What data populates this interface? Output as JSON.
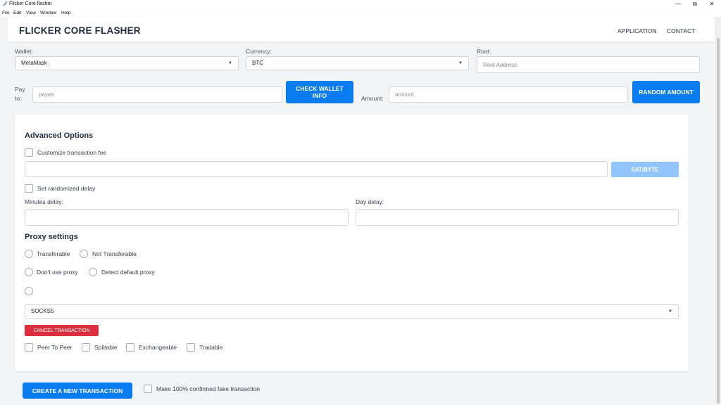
{
  "window": {
    "title": "Flicker Core flasher",
    "minimize": "—",
    "restore": "⧉",
    "close": "✕"
  },
  "menu": [
    "File",
    "Edit",
    "View",
    "Window",
    "Help"
  ],
  "navbar": {
    "brand": "FLICKER CORE FLASHER",
    "links": [
      "APPLICATION",
      "CONTACT"
    ]
  },
  "wallet": {
    "label": "Wallet:",
    "selected": "MetaMask"
  },
  "currency": {
    "label": "Currency:",
    "selected": "BTC"
  },
  "root": {
    "label": "Root:",
    "placeholder": "Root Address"
  },
  "pay_to": {
    "label": "Pay to:",
    "placeholder": "payee"
  },
  "check_wallet_button": "CHECK WALLET INFO",
  "amount": {
    "label": "Amount:",
    "placeholder": "amount"
  },
  "random_amount_button": "RANDOM AMOUNT",
  "advanced": {
    "title": "Advanced Options",
    "customize_fee_label": "Customize transaction fee",
    "sat_byte_button": "SAT/BYTE",
    "randomized_delay_label": "Set randomized delay",
    "minutes_delay_label": "Minutes delay:",
    "day_delay_label": "Day delay:"
  },
  "proxy": {
    "title": "Proxy settings",
    "radios": [
      "Transferable",
      "Not Transferable",
      "Don't use proxy",
      "Detect default proxy"
    ],
    "protocol_selected": "SOCKS5",
    "cancel_button": "CANCEL TRANSACTION",
    "checkboxes": [
      "Peer To Peer",
      "Splitable",
      "Exchangeable",
      "Tradable"
    ]
  },
  "footer": {
    "create_button": "CREATE A NEW TRANSACTION",
    "fake_label": "Make 100% confirmed fake transaction"
  },
  "colors": {
    "primary": "#0a7cf2",
    "primary_light": "#93c5fd",
    "danger": "#dc2f3e",
    "background": "#f3f4f6"
  },
  "icons": [
    "app-feather-icon",
    "caret-down-icon",
    "minimize-icon",
    "restore-icon",
    "close-icon"
  ]
}
